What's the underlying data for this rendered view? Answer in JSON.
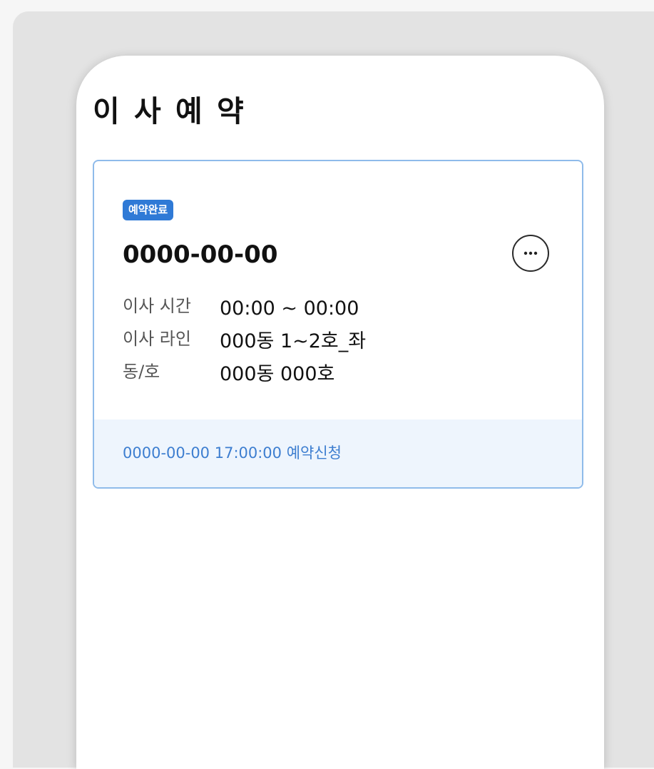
{
  "page": {
    "title": "이 사 예 약"
  },
  "reservation": {
    "status_badge": "예약완료",
    "date": "0000-00-00",
    "more_icon": "more-horizontal-icon",
    "details": [
      {
        "label": "이사 시간",
        "value": "00:00 ~ 00:00"
      },
      {
        "label": "이사 라인",
        "value": "000동 1~2호_좌"
      },
      {
        "label": "동/호",
        "value": "000동 000호"
      }
    ],
    "footer_text": "0000-00-00 17:00:00 예약신청"
  },
  "colors": {
    "badge": "#2f7ad6",
    "card_border": "#8fbbea",
    "footer_bg": "#eef5fd",
    "footer_text": "#3d7ed0"
  }
}
